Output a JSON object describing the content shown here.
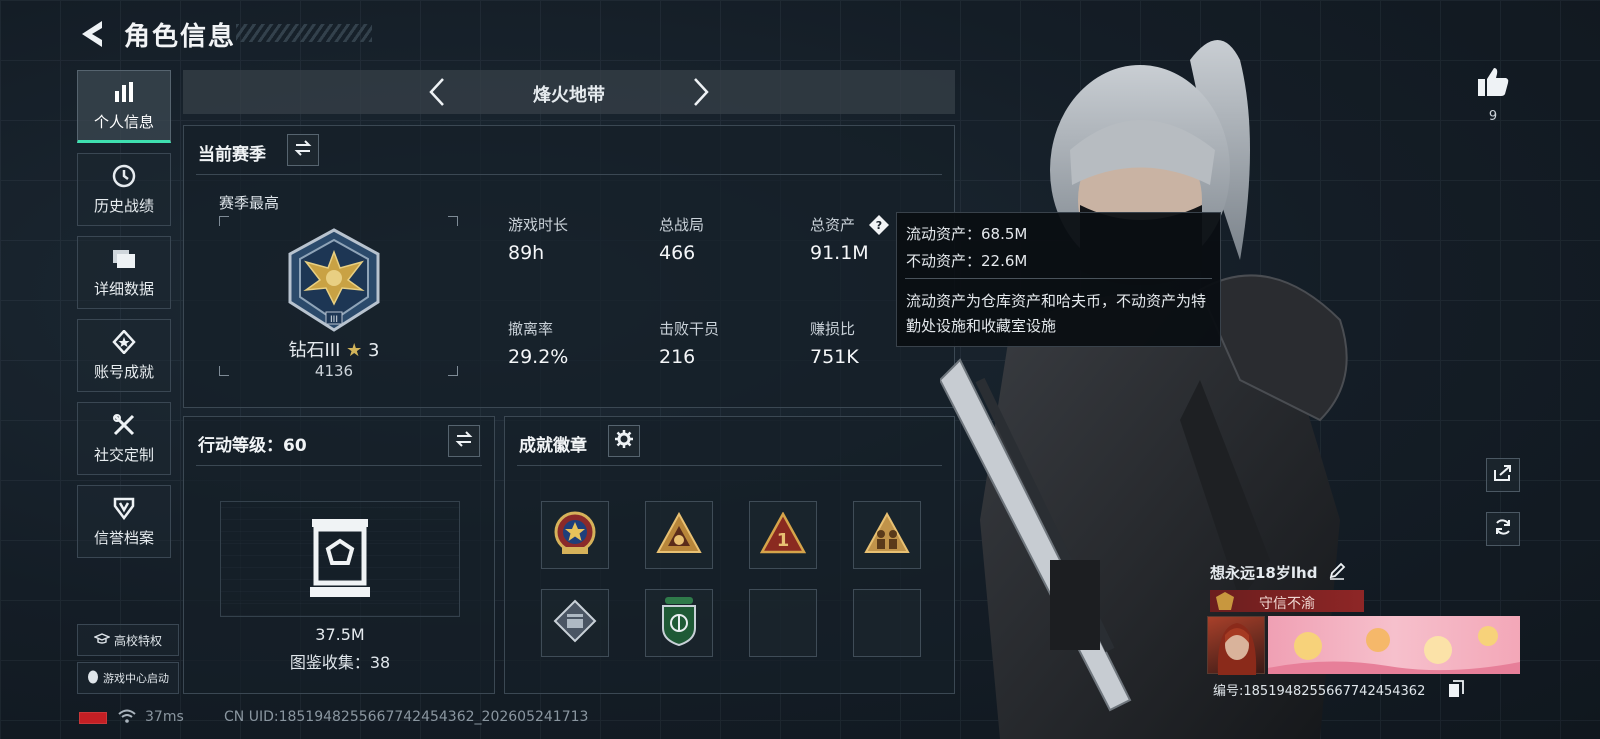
{
  "header": {
    "title": "角色信息"
  },
  "sidebar": {
    "items": [
      {
        "label": "个人信息",
        "icon": "bar-chart-icon",
        "active": true
      },
      {
        "label": "历史战绩",
        "icon": "clock-icon"
      },
      {
        "label": "详细数据",
        "icon": "folder-icon"
      },
      {
        "label": "账号成就",
        "icon": "medal-icon"
      },
      {
        "label": "社交定制",
        "icon": "tools-icon"
      },
      {
        "label": "信誉档案",
        "icon": "shield-icon"
      }
    ],
    "campus_button": "高校特权",
    "game_center_button": "游戏中心启动"
  },
  "mode": {
    "title": "烽火地带"
  },
  "season": {
    "title": "当前赛季",
    "best_label": "赛季最高",
    "rank_name": "钻石III",
    "rank_stars": "3",
    "rank_score": "4136",
    "stats": [
      {
        "label": "游戏时长",
        "value": "89h"
      },
      {
        "label": "总战局",
        "value": "466"
      },
      {
        "label": "总资产",
        "value": "91.1M"
      },
      {
        "label": "撤离率",
        "value": "29.2%"
      },
      {
        "label": "击败干员",
        "value": "216"
      },
      {
        "label": "赚损比",
        "value": "751K"
      }
    ]
  },
  "tooltip": {
    "liquid": "流动资产：68.5M",
    "fixed": "不动资产：22.6M",
    "description": "流动资产为仓库资产和哈夫币，不动资产为特勤处设施和收藏室设施"
  },
  "action_level": {
    "title": "行动等级：60",
    "collection_value": "37.5M",
    "collection_count": "图鉴收集：38"
  },
  "badges": {
    "title": "成就徽章",
    "slots": [
      "star-emblem-badge-icon",
      "triangle-shield-badge-icon",
      "number-one-badge-icon",
      "soldiers-badge-icon",
      "diamond-crate-badge-icon",
      "green-shield-badge-icon",
      "empty",
      "empty"
    ]
  },
  "profile": {
    "like_count": "9",
    "player_name": "想永远18岁lhd",
    "title": "守信不渝",
    "player_id": "编号:1851948255667742454362"
  },
  "status": {
    "ping": "37ms",
    "uid": "CN UID:1851948255667742454362_202605241713"
  },
  "colors": {
    "accent": "#3fe0b0",
    "background": "#131c25",
    "title_banner": "#8e2626",
    "battery_low": "#c41f24"
  }
}
